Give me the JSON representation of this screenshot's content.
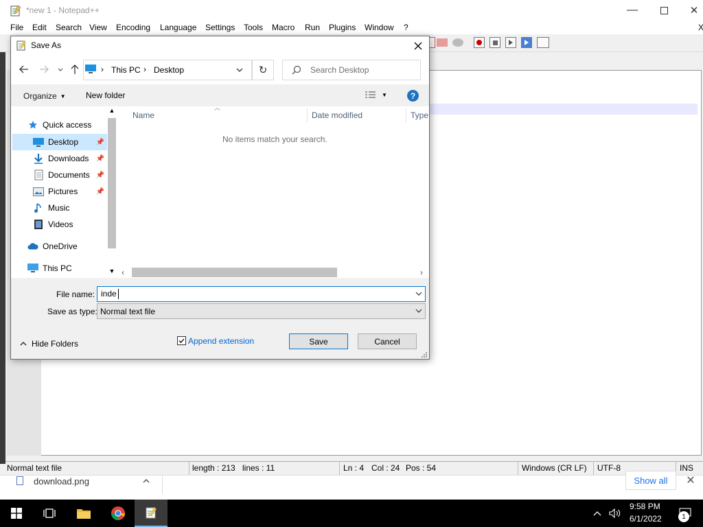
{
  "npp": {
    "title": "*new 1 - Notepad++",
    "menu": [
      "File",
      "Edit",
      "Search",
      "View",
      "Encoding",
      "Language",
      "Settings",
      "Tools",
      "Macro",
      "Run",
      "Plugins",
      "Window",
      "?"
    ],
    "close_label": "X"
  },
  "status": {
    "type": "Normal text file",
    "length": "length : 213",
    "lines": "lines : 11",
    "ln": "Ln : 4",
    "col": "Col : 24",
    "pos": "Pos : 54",
    "eol": "Windows (CR LF)",
    "encoding": "UTF-8",
    "mode": "INS"
  },
  "download": {
    "file": "download.png",
    "show_all": "Show all"
  },
  "taskbar": {
    "time": "9:58 PM",
    "date": "6/1/2022",
    "notif_count": "1"
  },
  "dialog": {
    "title": "Save As",
    "breadcrumb": [
      "This PC",
      "Desktop"
    ],
    "search_placeholder": "Search Desktop",
    "organize": "Organize",
    "new_folder": "New folder",
    "help": "?",
    "nav": [
      {
        "label": "Quick access",
        "icon": "star-icon"
      },
      {
        "label": "Desktop",
        "icon": "desktop-icon",
        "selected": true
      },
      {
        "label": "Downloads",
        "icon": "download-icon"
      },
      {
        "label": "Documents",
        "icon": "documents-icon"
      },
      {
        "label": "Pictures",
        "icon": "pictures-icon"
      },
      {
        "label": "Music",
        "icon": "music-icon"
      },
      {
        "label": "Videos",
        "icon": "videos-icon"
      },
      {
        "label": "OneDrive",
        "icon": "cloud-icon"
      },
      {
        "label": "This PC",
        "icon": "pc-icon"
      }
    ],
    "columns": {
      "name": "Name",
      "date": "Date modified",
      "type": "Type"
    },
    "empty_message": "No items match your search.",
    "file_name_label": "File name:",
    "file_name_value": "inde",
    "save_type_label": "Save as type:",
    "save_type_value": "Normal text file",
    "hide_folders": "Hide Folders",
    "append_extension": "Append extension",
    "append_checked": true,
    "save": "Save",
    "cancel": "Cancel"
  },
  "colors": {
    "accent": "#0078d7",
    "selected_bg": "#cce8ff",
    "help_blue": "#1e73be"
  }
}
